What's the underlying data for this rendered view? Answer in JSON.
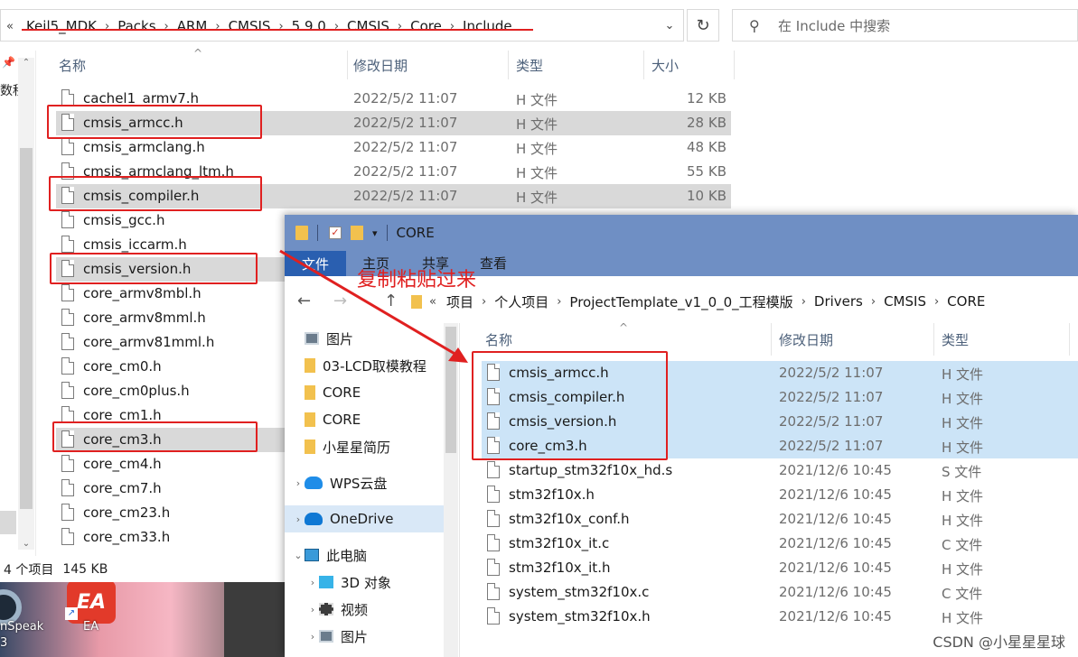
{
  "background_window": {
    "address": {
      "lead": "«",
      "segments": [
        "Keil5_MDK",
        "Packs",
        "ARM",
        "CMSIS",
        "5.9.0",
        "CMSIS",
        "Core",
        "Include"
      ],
      "dropdown_icon": "chevron-down-icon",
      "refresh_icon": "refresh-icon"
    },
    "search": {
      "placeholder": "在 Include 中搜索",
      "icon": "search-icon"
    },
    "left_pane_text": "数程",
    "columns": {
      "name": "名称",
      "date": "修改日期",
      "type": "类型",
      "size": "大小"
    },
    "files": [
      {
        "name": "cachel1_armv7.h",
        "date": "2022/5/2 11:07",
        "type": "H 文件",
        "size": "12 KB",
        "selected": false
      },
      {
        "name": "cmsis_armcc.h",
        "date": "2022/5/2 11:07",
        "type": "H 文件",
        "size": "28 KB",
        "selected": true
      },
      {
        "name": "cmsis_armclang.h",
        "date": "2022/5/2 11:07",
        "type": "H 文件",
        "size": "48 KB",
        "selected": false
      },
      {
        "name": "cmsis_armclang_ltm.h",
        "date": "2022/5/2 11:07",
        "type": "H 文件",
        "size": "55 KB",
        "selected": false
      },
      {
        "name": "cmsis_compiler.h",
        "date": "2022/5/2 11:07",
        "type": "H 文件",
        "size": "10 KB",
        "selected": true
      },
      {
        "name": "cmsis_gcc.h",
        "date": "",
        "type": "",
        "size": "",
        "selected": false
      },
      {
        "name": "cmsis_iccarm.h",
        "date": "",
        "type": "",
        "size": "",
        "selected": false
      },
      {
        "name": "cmsis_version.h",
        "date": "",
        "type": "",
        "size": "",
        "selected": true
      },
      {
        "name": "core_armv8mbl.h",
        "date": "",
        "type": "",
        "size": "",
        "selected": false
      },
      {
        "name": "core_armv8mml.h",
        "date": "",
        "type": "",
        "size": "",
        "selected": false
      },
      {
        "name": "core_armv81mml.h",
        "date": "",
        "type": "",
        "size": "",
        "selected": false
      },
      {
        "name": "core_cm0.h",
        "date": "",
        "type": "",
        "size": "",
        "selected": false
      },
      {
        "name": "core_cm0plus.h",
        "date": "",
        "type": "",
        "size": "",
        "selected": false
      },
      {
        "name": "core_cm1.h",
        "date": "",
        "type": "",
        "size": "",
        "selected": false
      },
      {
        "name": "core_cm3.h",
        "date": "",
        "type": "",
        "size": "",
        "selected": true
      },
      {
        "name": "core_cm4.h",
        "date": "",
        "type": "",
        "size": "",
        "selected": false
      },
      {
        "name": "core_cm7.h",
        "date": "",
        "type": "",
        "size": "",
        "selected": false
      },
      {
        "name": "core_cm23.h",
        "date": "",
        "type": "",
        "size": "",
        "selected": false
      },
      {
        "name": "core_cm33.h",
        "date": "",
        "type": "",
        "size": "",
        "selected": false
      }
    ],
    "status": {
      "count": "4 个项目",
      "size": "145 KB"
    }
  },
  "desktop": {
    "icon1_label": "nSpeak",
    "icon1_sub": "3",
    "ea_logo": "EA",
    "ea_label": "EA"
  },
  "annotation": "复制粘贴过来",
  "foreground_window": {
    "title": "CORE",
    "ribbon_tabs": [
      "文件",
      "主页",
      "共享",
      "查看"
    ],
    "nav": {
      "back": "←",
      "forward": "→",
      "up": "↑"
    },
    "address": {
      "lead": "«",
      "segments": [
        "项目",
        "个人项目",
        "ProjectTemplate_v1_0_0_工程模版",
        "Drivers",
        "CMSIS",
        "CORE"
      ]
    },
    "nav_pane": [
      {
        "label": "图片",
        "icon": "pictures-icon",
        "expander": ""
      },
      {
        "label": "03-LCD取模教程",
        "icon": "folder-icon",
        "expander": ""
      },
      {
        "label": "CORE",
        "icon": "folder-icon",
        "expander": ""
      },
      {
        "label": "CORE",
        "icon": "folder-icon",
        "expander": ""
      },
      {
        "label": "小星星简历",
        "icon": "folder-icon",
        "expander": ""
      },
      {
        "label": "WPS云盘",
        "icon": "wps-cloud-icon",
        "expander": "›"
      },
      {
        "label": "OneDrive",
        "icon": "onedrive-icon",
        "expander": "›"
      },
      {
        "label": "此电脑",
        "icon": "this-pc-icon",
        "expander": "⌄"
      },
      {
        "label": "3D 对象",
        "icon": "3d-objects-icon",
        "expander": "›"
      },
      {
        "label": "视频",
        "icon": "video-icon",
        "expander": "›"
      },
      {
        "label": "图片",
        "icon": "pictures-icon",
        "expander": "›"
      }
    ],
    "columns": {
      "name": "名称",
      "date": "修改日期",
      "type": "类型"
    },
    "files": [
      {
        "name": "cmsis_armcc.h",
        "date": "2022/5/2 11:07",
        "type": "H 文件",
        "selected": true
      },
      {
        "name": "cmsis_compiler.h",
        "date": "2022/5/2 11:07",
        "type": "H 文件",
        "selected": true
      },
      {
        "name": "cmsis_version.h",
        "date": "2022/5/2 11:07",
        "type": "H 文件",
        "selected": true
      },
      {
        "name": "core_cm3.h",
        "date": "2022/5/2 11:07",
        "type": "H 文件",
        "selected": true
      },
      {
        "name": "startup_stm32f10x_hd.s",
        "date": "2021/12/6 10:45",
        "type": "S 文件",
        "selected": false
      },
      {
        "name": "stm32f10x.h",
        "date": "2021/12/6 10:45",
        "type": "H 文件",
        "selected": false
      },
      {
        "name": "stm32f10x_conf.h",
        "date": "2021/12/6 10:45",
        "type": "H 文件",
        "selected": false
      },
      {
        "name": "stm32f10x_it.c",
        "date": "2021/12/6 10:45",
        "type": "C 文件",
        "selected": false
      },
      {
        "name": "stm32f10x_it.h",
        "date": "2021/12/6 10:45",
        "type": "H 文件",
        "selected": false
      },
      {
        "name": "system_stm32f10x.c",
        "date": "2021/12/6 10:45",
        "type": "C 文件",
        "selected": false
      },
      {
        "name": "system_stm32f10x.h",
        "date": "2021/12/6 10:45",
        "type": "H 文件",
        "selected": false
      }
    ]
  },
  "watermark": "CSDN @小星星星球",
  "colors": {
    "highlight_red": "#e02020",
    "title_blue": "#6f8fc4",
    "ribbon_active": "#2a5fb0",
    "selection_blue": "#cce4f7",
    "selection_gray": "#d9d9d9"
  }
}
